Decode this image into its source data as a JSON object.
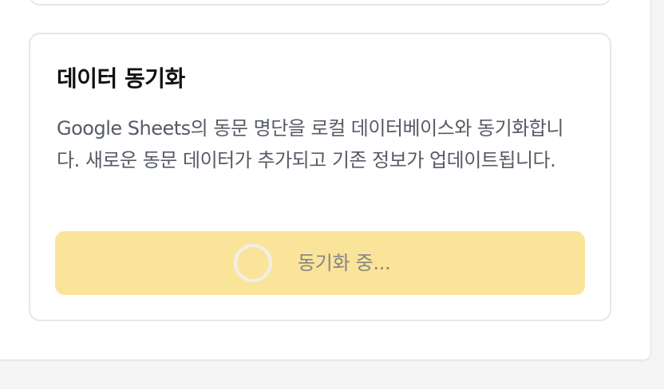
{
  "sync_card": {
    "title": "데이터 동기화",
    "description": "Google Sheets의 동문 명단을 로컬 데이터베이스와 동기화합니다. 새로운 동문 데이터가 추가되고 기존 정보가 업데이트됩니다.",
    "button": {
      "label": "동기화 중...",
      "state": "loading",
      "icon": "spinner-icon"
    }
  },
  "colors": {
    "button_bg": "#f9e49a",
    "button_text": "#858585",
    "title": "#111111",
    "description": "#555b66",
    "page_bg": "#f5f5f5"
  }
}
